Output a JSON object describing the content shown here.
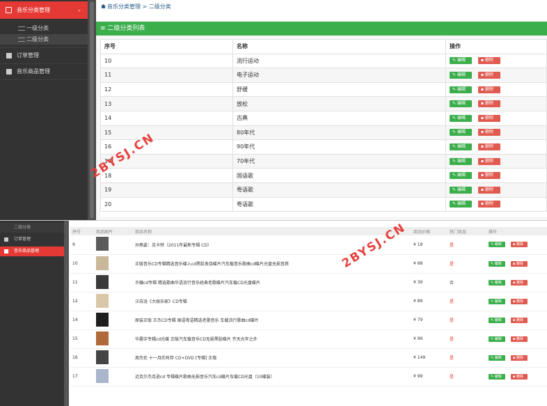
{
  "top": {
    "sidebar": {
      "header": "音乐分类管理",
      "sub_items": [
        {
          "label": "一级分类"
        },
        {
          "label": "二级分类"
        }
      ],
      "items": [
        {
          "label": "订单管理"
        },
        {
          "label": "音乐商品管理"
        }
      ]
    },
    "breadcrumb": {
      "root": "音乐分类管理",
      "sep": ">",
      "current": "二级分类"
    },
    "panel_title": "二级分类列表",
    "columns": [
      "序号",
      "名称",
      "操作"
    ],
    "edit_label": "编辑",
    "delete_label": "删除",
    "rows": [
      {
        "id": "10",
        "name": "流行运动"
      },
      {
        "id": "11",
        "name": "电子运动"
      },
      {
        "id": "12",
        "name": "舒缓"
      },
      {
        "id": "13",
        "name": "放松"
      },
      {
        "id": "14",
        "name": "古典"
      },
      {
        "id": "15",
        "name": "80年代"
      },
      {
        "id": "16",
        "name": "90年代"
      },
      {
        "id": "17",
        "name": "70年代"
      },
      {
        "id": "18",
        "name": "国语歌"
      },
      {
        "id": "19",
        "name": "粤语歌"
      },
      {
        "id": "20",
        "name": "粤语歌"
      }
    ]
  },
  "bottom": {
    "sidebar": {
      "items": [
        {
          "label": "二级分类"
        },
        {
          "label": "订单管理"
        },
        {
          "label": "音乐商品管理"
        }
      ]
    },
    "columns": [
      "序号",
      "商品图片",
      "商品名称",
      "商品价格",
      "热门商品",
      "操作"
    ],
    "edit_label": "编辑",
    "delete_label": "删除",
    "rows": [
      {
        "id": "9",
        "name": "孙燕姿：克卡特（2011年最新专辑 CD）",
        "price": "¥ 19",
        "hot": "是"
      },
      {
        "id": "10",
        "name": "正版音乐CD专辑精选音乐碟入cd黑胶发烧碟片汽车载音乐歌曲cd碟片光盘无损音质",
        "price": "¥ 68",
        "hot": "是"
      },
      {
        "id": "11",
        "name": "许巍cd专辑 精选歌曲华语流行音乐经典老歌碟片汽车载CD光盘碟片",
        "price": "¥ 39",
        "hot": "否"
      },
      {
        "id": "12",
        "name": "汪苏泷《大娱乐家》CD专辑",
        "price": "¥ 89",
        "hot": "是"
      },
      {
        "id": "14",
        "name": "原装正版 王杰CD专辑 国语粤语精选老歌音乐 车载流行歌曲cd碟片",
        "price": "¥ 79",
        "hot": "是"
      },
      {
        "id": "15",
        "name": "华晨宇专辑cd光碟 正版汽车载音乐CD无损黑胶碟片 齐天光年之外",
        "price": "¥ 99",
        "hot": "是"
      },
      {
        "id": "16",
        "name": "周杰伦 十一月的肖邦 CD+DVD [专辑] 正版",
        "price": "¥ 149",
        "hot": "是"
      },
      {
        "id": "17",
        "name": "迈克尔杰克逊cd 专辑碟片歌曲无损音乐汽车cd碟片车载CD光盘（10碟装）",
        "price": "¥ 99",
        "hot": "是"
      }
    ]
  },
  "watermark": "2BYSJ.CN",
  "colors": {
    "accent_red": "#e53935",
    "green": "#3cae4c",
    "sidebar": "#333333"
  }
}
